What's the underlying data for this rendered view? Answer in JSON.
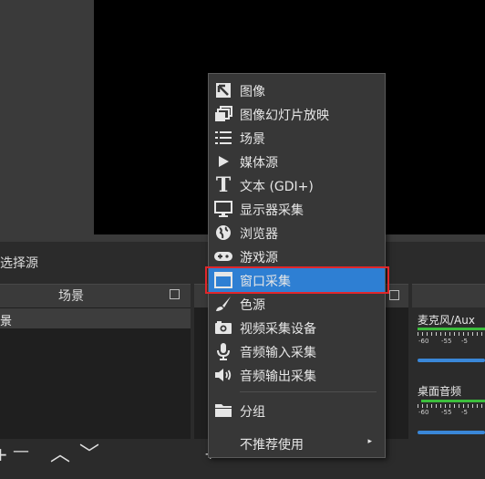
{
  "sources_dock": {
    "title": "选择源"
  },
  "scenes": {
    "title": "场景",
    "selected_scene": "景"
  },
  "scenes_toolbar": {
    "add": "+",
    "remove": "—",
    "up": "︿",
    "down": "﹀"
  },
  "sources_toolbar": {
    "add": "+"
  },
  "mixer": {
    "channels": [
      {
        "name": "麦克风/Aux",
        "db_labels": [
          "-60",
          "-55",
          "-5"
        ]
      },
      {
        "name": "桌面音频",
        "db_labels": [
          "-60",
          "-55",
          "-5"
        ]
      }
    ]
  },
  "context_menu": {
    "items": [
      {
        "label": "图像",
        "icon": "image-icon"
      },
      {
        "label": "图像幻灯片放映",
        "icon": "slideshow-icon"
      },
      {
        "label": "场景",
        "icon": "list-icon"
      },
      {
        "label": "媒体源",
        "icon": "play-icon"
      },
      {
        "label": "文本 (GDI+)",
        "icon": "text-icon"
      },
      {
        "label": "显示器采集",
        "icon": "monitor-icon"
      },
      {
        "label": "浏览器",
        "icon": "globe-icon"
      },
      {
        "label": "游戏源",
        "icon": "gamepad-icon"
      },
      {
        "label": "窗口采集",
        "icon": "window-icon",
        "selected": true
      },
      {
        "label": "色源",
        "icon": "brush-icon"
      },
      {
        "label": "视频采集设备",
        "icon": "camera-icon"
      },
      {
        "label": "音频输入采集",
        "icon": "microphone-icon"
      },
      {
        "label": "音频输出采集",
        "icon": "speaker-icon"
      },
      {
        "label": "分组",
        "icon": "folder-icon"
      },
      {
        "label": "不推荐使用",
        "icon": "",
        "submenu": true
      }
    ],
    "submenu_arrow": "▸"
  },
  "colors": {
    "selection": "#2e7fd3",
    "highlight_box": "#e0262b",
    "meter": "#3cbd3c",
    "volume": "#3a87d8"
  }
}
